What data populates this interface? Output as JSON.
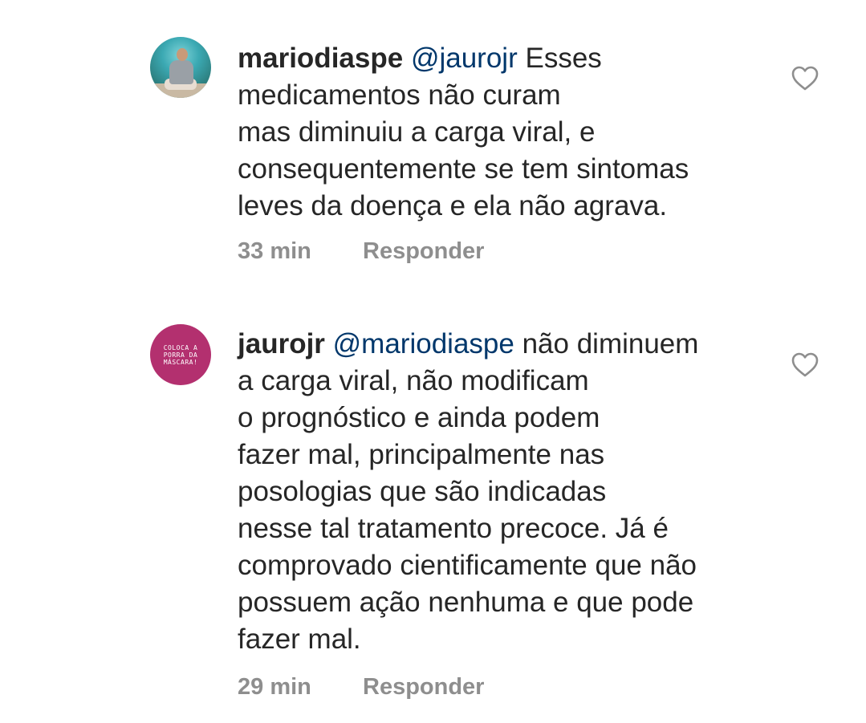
{
  "comments": [
    {
      "username": "mariodiaspe",
      "mention": "@jaurojr",
      "text_first": "Esses",
      "lines": [
        "medicamentos não curam",
        "mas diminuiu a carga viral, e",
        "consequentemente se tem sintomas",
        "leves da doença e ela não agrava."
      ],
      "time": "33 min",
      "reply_label": "Responder",
      "avatar_icon": "profile-photo"
    },
    {
      "username": "jaurojr",
      "mention": "@mariodiaspe",
      "text_first": "não diminuem",
      "lines": [
        "a carga viral, não modificam",
        "o prognóstico e ainda podem",
        "fazer mal, principalmente nas",
        "posologias que são indicadas",
        "nesse tal tratamento precoce. Já é",
        "comprovado cientificamente que não",
        "possuem ação nenhuma e que pode",
        "fazer mal."
      ],
      "time": "29 min",
      "reply_label": "Responder",
      "avatar_text": "COLOCA A PORRA DA MÁSCARA!",
      "avatar_color": "#b3306f"
    }
  ],
  "colors": {
    "text": "#262626",
    "mention": "#00376b",
    "meta": "#8e8e8e",
    "background": "#ffffff"
  },
  "icons": {
    "like": "heart-outline-icon"
  }
}
